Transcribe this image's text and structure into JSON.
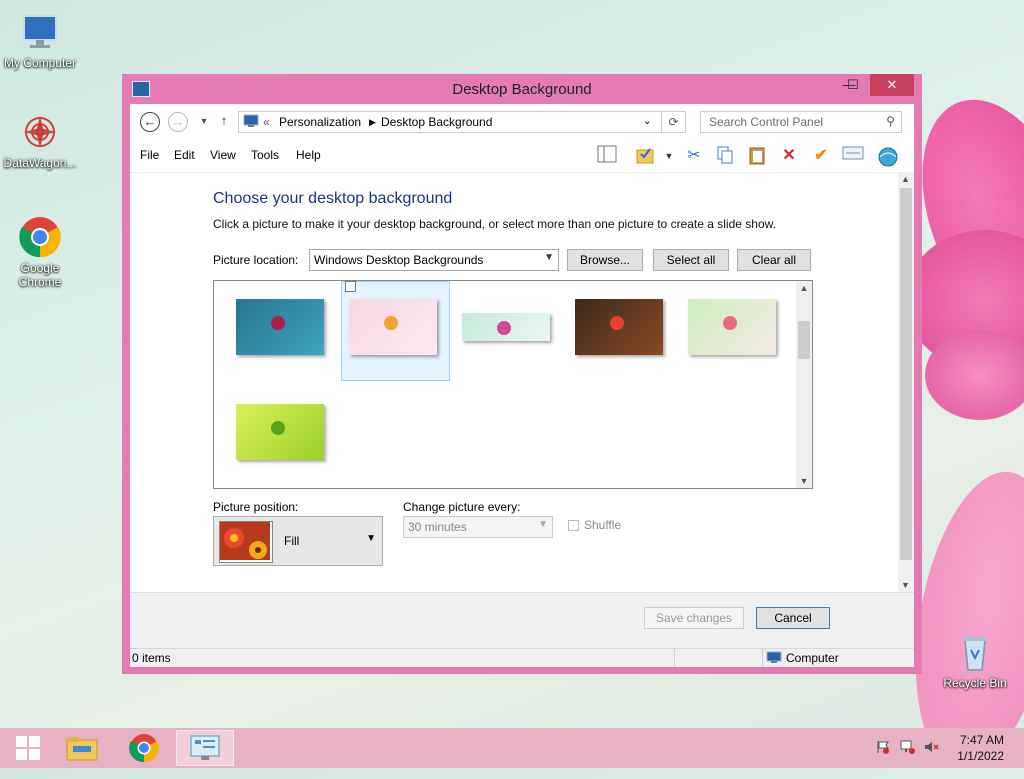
{
  "desktop": {
    "icons": [
      {
        "label": "My Computer"
      },
      {
        "label": "DataWagon..."
      },
      {
        "label": "Google Chrome"
      },
      {
        "label": "Recycle Bin"
      }
    ]
  },
  "window": {
    "title": "Desktop Background",
    "controls": {
      "minimize": "—",
      "maximize": "☐",
      "close": "✕"
    },
    "address": {
      "prefix": "«",
      "breadcrumb": [
        "Personalization",
        "Desktop Background"
      ]
    },
    "search_placeholder": "Search Control Panel",
    "menu": [
      "File",
      "Edit",
      "View",
      "Tools",
      "Help"
    ],
    "heading": "Choose your desktop background",
    "subtext": "Click a picture to make it your desktop background, or select more than one picture to create a slide show.",
    "picture_location": {
      "label": "Picture location:",
      "value": "Windows Desktop Backgrounds",
      "buttons": {
        "browse": "Browse...",
        "select_all": "Select all",
        "clear_all": "Clear all"
      }
    },
    "gallery": {
      "selected_index": 1,
      "thumbnails": [
        {
          "colors": [
            "#27758f",
            "#3fa4bf",
            "#a8214a"
          ]
        },
        {
          "colors": [
            "#f6d9e5",
            "#fbe8f0",
            "#f2a23a"
          ]
        },
        {
          "colors": [
            "#c7e9da",
            "#e9f7f2",
            "#d24b8f"
          ]
        },
        {
          "colors": [
            "#3b2a1c",
            "#8a4a24",
            "#e3412d"
          ]
        },
        {
          "colors": [
            "#cfeec0",
            "#f4e9e5",
            "#e96a83"
          ]
        },
        {
          "colors": [
            "#d9ef5a",
            "#9cd12b",
            "#5aa21a"
          ]
        }
      ]
    },
    "picture_position": {
      "label": "Picture position:",
      "value": "Fill"
    },
    "change_picture": {
      "label": "Change picture every:",
      "value": "30 minutes"
    },
    "shuffle": {
      "label": "Shuffle",
      "checked": false
    },
    "buttons": {
      "save": "Save changes",
      "cancel": "Cancel"
    },
    "status": {
      "items": "0 items",
      "location": "Computer"
    }
  },
  "taskbar": {
    "clock": {
      "time": "7:47 AM",
      "date": "1/1/2022"
    }
  }
}
